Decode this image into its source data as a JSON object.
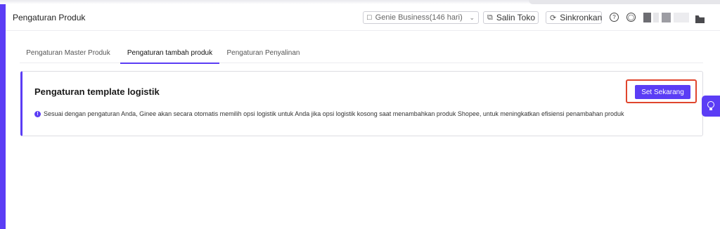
{
  "header": {
    "title": "Pengaturan Produk",
    "store_selector": {
      "label": "Genie Business(146 hari)",
      "icon": "calendar-icon"
    },
    "copy_store_label": "Salin Toko",
    "sync_label": "Sinkronkan"
  },
  "tabs": [
    {
      "label": "Pengaturan Master Produk",
      "active": false
    },
    {
      "label": "Pengaturan tambah produk",
      "active": true
    },
    {
      "label": "Pengaturan Penyalinan",
      "active": false
    }
  ],
  "card": {
    "title": "Pengaturan template logistik",
    "button_label": "Set Sekarang",
    "info_text": "Sesuai dengan pengaturan Anda, Ginee akan secara otomatis memilih opsi logistik untuk Anda jika opsi logistik kosong saat menambahkan produk Shopee, untuk meningkatkan efisiensi penambahan produk"
  },
  "colors": {
    "accent": "#5b3df5",
    "highlight": "#e0452d"
  }
}
